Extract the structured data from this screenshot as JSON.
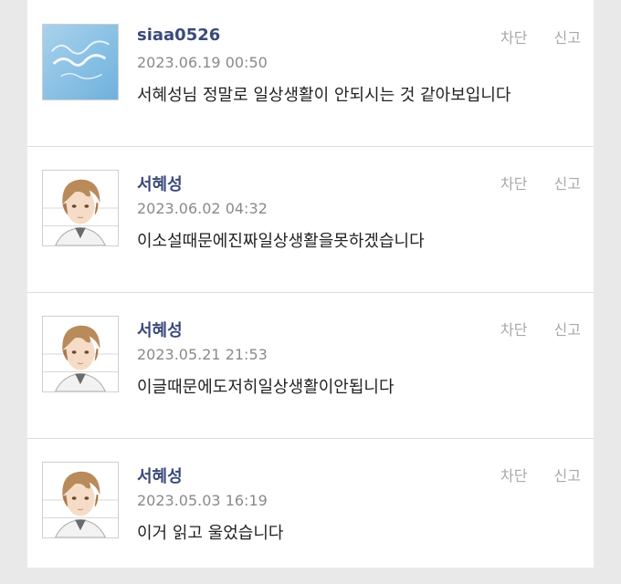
{
  "comments": [
    {
      "avatar": "enjoy-avatar",
      "author": "siaa0526",
      "date": "2023.06.19 00:50",
      "text": "서혜성님 정말로 일상생활이 안되시는 것 같아보입니다",
      "block_label": "차단",
      "report_label": "신고"
    },
    {
      "avatar": "anime-boy-avatar",
      "author": "서혜성",
      "date": "2023.06.02 04:32",
      "text": "이소설때문에진짜일상생활을못하겠습니다",
      "block_label": "차단",
      "report_label": "신고"
    },
    {
      "avatar": "anime-boy-avatar",
      "author": "서혜성",
      "date": "2023.05.21 21:53",
      "text": "이글때문에도저히일상생활이안됩니다",
      "block_label": "차단",
      "report_label": "신고"
    },
    {
      "avatar": "anime-boy-avatar",
      "author": "서혜성",
      "date": "2023.05.03 16:19",
      "text": "이거 읽고 울었습니다",
      "block_label": "차단",
      "report_label": "신고"
    }
  ],
  "colors": {
    "author": "#3a4a7a",
    "date": "#8a8a8a",
    "action": "#a8a8a8",
    "divider": "#dcdcdc"
  }
}
